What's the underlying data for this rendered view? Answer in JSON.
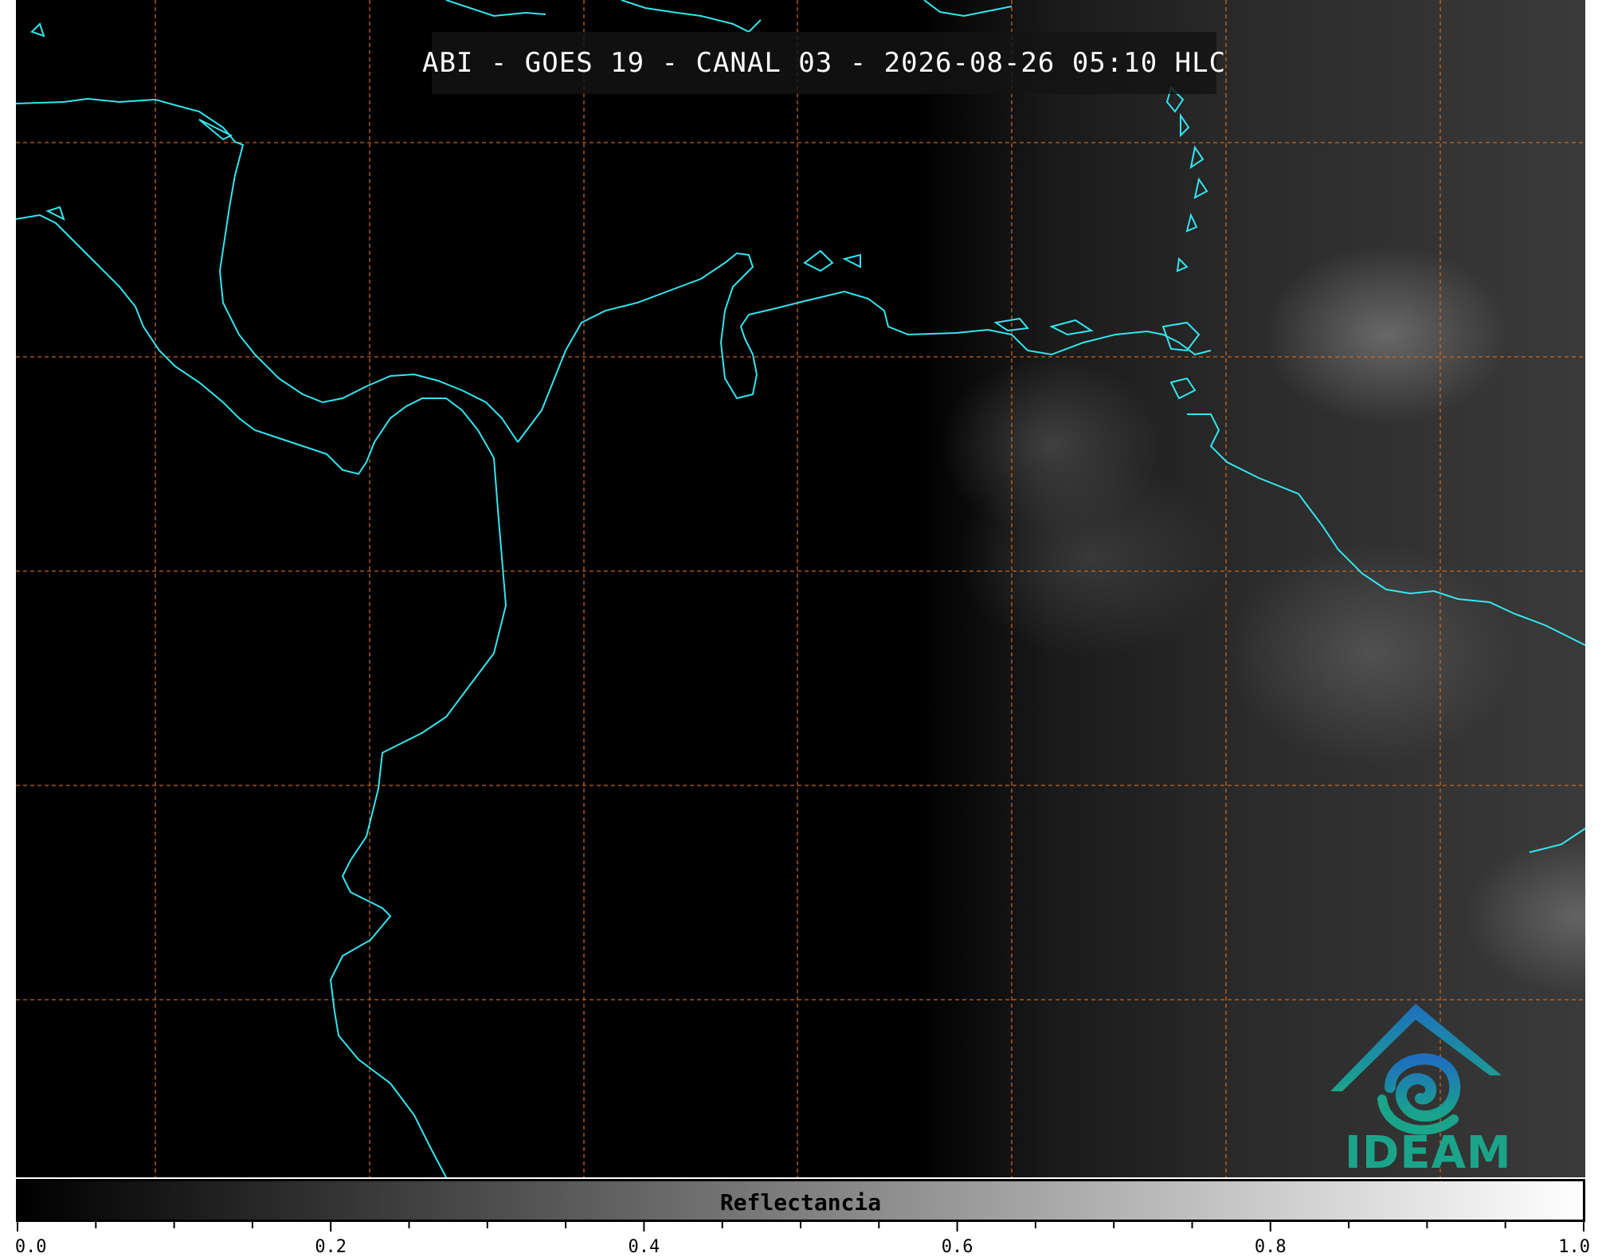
{
  "title": "ABI - GOES 19 - CANAL 03 - 2026-08-26 05:10 HLC",
  "colorbar": {
    "label": "Reflectancia",
    "min": 0.0,
    "max": 1.0,
    "ticks": [
      "0.0",
      "0.2",
      "0.4",
      "0.6",
      "0.8",
      "1.0"
    ],
    "gradient": [
      "#000000",
      "#ffffff"
    ]
  },
  "logo": {
    "text": "IDEAM",
    "colors": [
      "#1e6fc0",
      "#1aa58a"
    ]
  },
  "colors": {
    "coastline": "#33e6f0",
    "gridline": "#d2691e",
    "background": "#000000"
  },
  "icons": [
    "ideam-logo-icon"
  ]
}
